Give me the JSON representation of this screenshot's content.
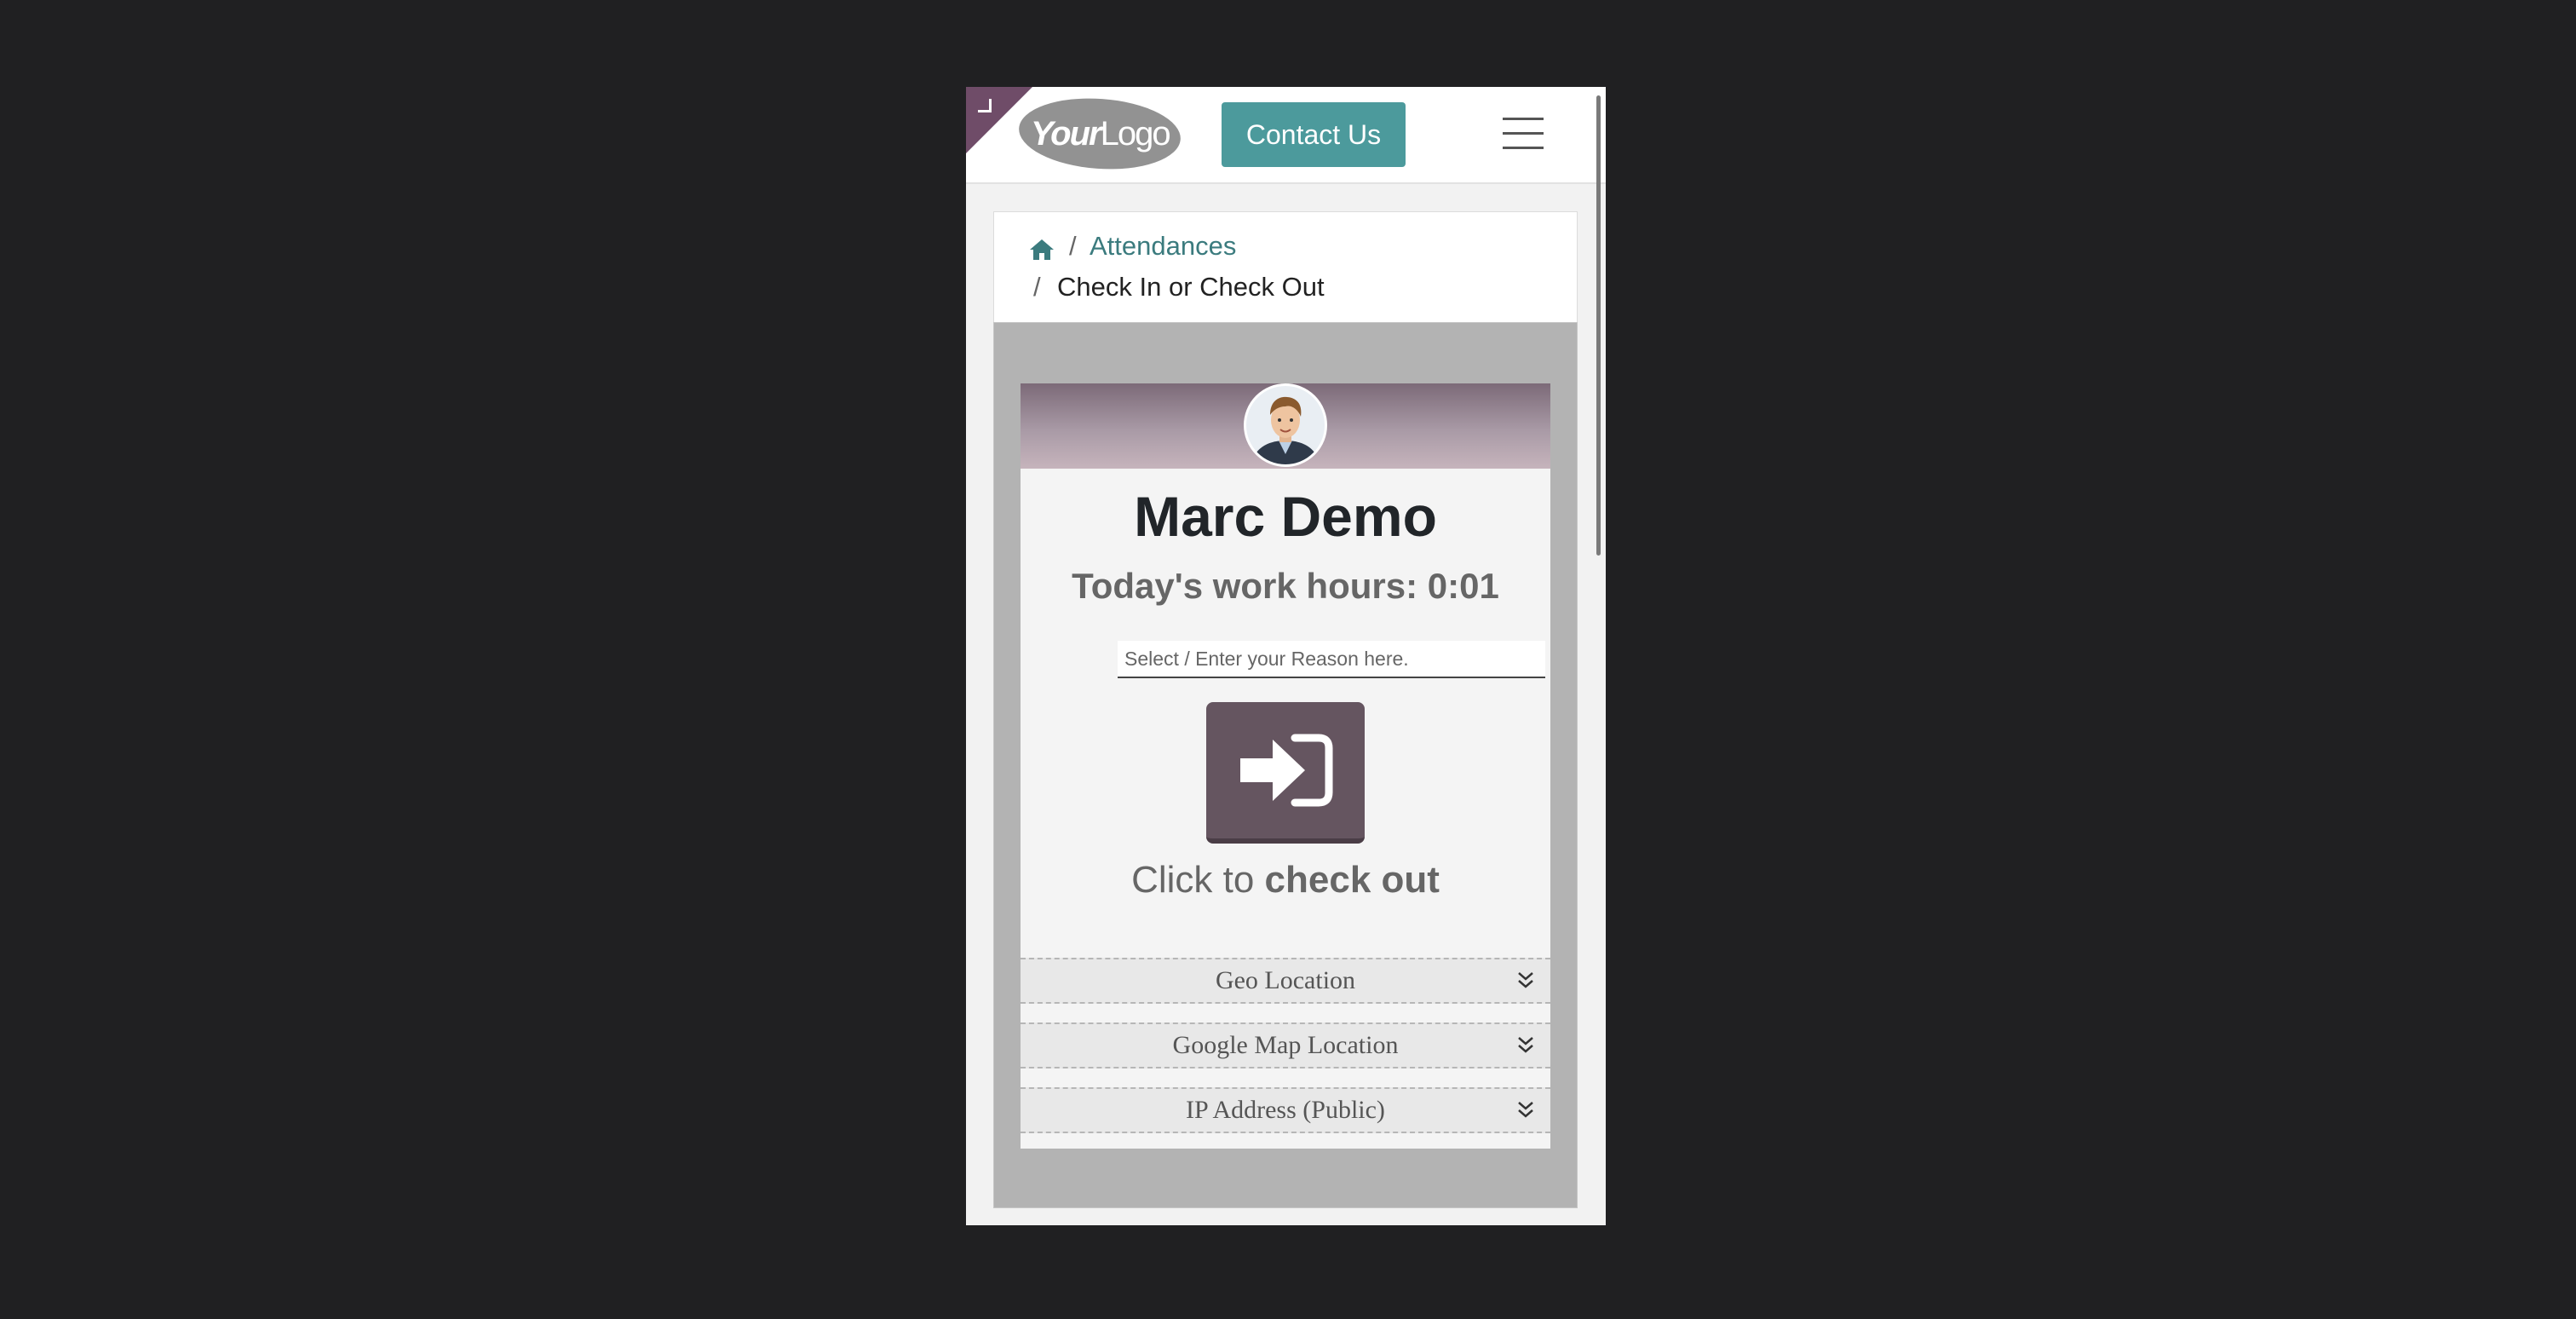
{
  "header": {
    "logo": {
      "text_bold": "Your",
      "text_regular": "Logo"
    },
    "contact_label": "Contact Us",
    "menu_icon": "hamburger-menu-icon",
    "corner_icon": "edit-corner-icon"
  },
  "breadcrumb": {
    "home_icon": "home-icon",
    "separator": "/",
    "link": "Attendances",
    "current": "Check In or Check Out"
  },
  "employee": {
    "name": "Marc Demo",
    "work_hours": "Today's work hours: 0:01",
    "avatar_icon": "employee-avatar"
  },
  "reason": {
    "placeholder": "Select / Enter your Reason here."
  },
  "checkout": {
    "icon": "sign-in-arrow-icon",
    "text_prefix": "Click to",
    "text_bold": "check out"
  },
  "sections": [
    {
      "label": "Geo Location",
      "icon": "double-chevron-down-icon"
    },
    {
      "label": "Google Map Location",
      "icon": "double-chevron-down-icon"
    },
    {
      "label": "IP Address (Public)",
      "icon": "double-chevron-down-icon"
    }
  ],
  "colors": {
    "primary": "#655560",
    "accent": "#4c9a9c",
    "link": "#3b7b7e",
    "corner": "#6f4c68"
  }
}
